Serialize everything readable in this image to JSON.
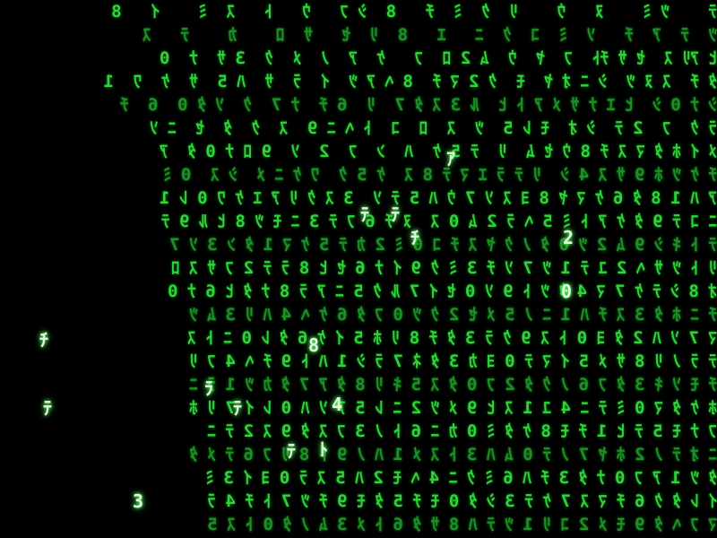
{
  "colors": {
    "background": "#000000",
    "glyph": "#2fd43a",
    "glyph_dim": "#1f8f29",
    "glyph_head": "#d9ffd9"
  },
  "rain": {
    "lines": [
      "ﾃ    ﾂ ﾐ    ﾇ   ｳ    ﾘ  ｸ  ﾐ  ﾁ   8  ｼ ﾌ   ｳ   ﾄ   ｽ  ﾐ    ｲ   8",
      "ﾂ  ﾃ  ｱ  ﾁ   ｿ  ﾐ  ｺ  ｸ  ﾆ   ｴ   8  ﾘ  ｾ   ｻ  ﾛ    ｶ    ﾃ   ｽ",
      "ﾋ ｱﾘ ｽ  ｾ ｻ ﾁﾄ  ﾌ  ﾔ  ｳ  ﾑ 2 ﾛ  ﾌ   ｹ  ｱ  ﾉ  ﾒ  ｸ  3 ｻ  ﾅ  0",
      "ﾀ ﾁ  ｽ ﾇ ﾂ  ｼ ﾆ ｵ ﾔ  ﾓ  ｸ 2 ﾏ ﾁ  8 ﾍ ｱ ﾂ  ｲ  ﾗ  ｻ  ﾊ 5  ｻ  ｹ  ﾜ  1",
      "ｼ ﾅ 0 ｼ  ﾋ ｴ ﾅ ｻ ﾒ ｱ ﾄ ﾋ  ﾙ 3 ｽ ﾀ 7  ﾘ  6 ﾁ  ﾅ 7  ｸ  ｿ ﾀ 0  6  ﾁ",
      "ﾗ ｸ  ﾌ  2 ﾃ  ｼ ｵ  ﾓ ﾚ 5  ﾂ  ｽ  ﾛ  ｺ  ﾄ ﾍ ﾆ 9  ｽ  ｸ  ﾀ  ｾ  ﾆ ｿ",
      "ﾒ ｲ ﾎ ﾀ ﾏ ｽ ﾁ 8 ｳ ｾ ﾑ  ﾘ  ﾃ 5 ｹ  ﾊ  ﾝ  ﾌ  2  ｿ  9 ﾛ ﾅ 0 ﾀ  ｱ",
      "ﾁ ｹ ﾂ ﾎ 9 ｻ ｽ 4 ｼ  ﾘ ﾃ ﾗ ｴ ﾏ ﾃ 8 ｽ  ｹ 5 ｸ  ﾜ ｹ ﾆ ﾒ  ｼ ｽ  0 ﾐ",
      "ｱ ﾊ 1 8 ﾀ 6 ｹ ﾏ ﾔ 8 ﾖ ｽ ｿ 7 ｳ ﾊ 5 ﾃ ｿ  3 ｽ ｸ ﾘ ｱ ｴ ｹ ﾜ 0 ﾚ 1",
      "ﾆ ｺ ﾃ 9 ﾀ ｹ ｱ ﾄ ﾐ 5 ﾍ ﾗ 2 ﾑ 0 ｽ  ﾇ ﾁ 6 ﾌ ﾃ 3 ﾆ ﾓ ﾂ 8 ﾋ ﾙ 9 ﾃ",
      "ﾃ ﾄ ｷ ｼ 9 ﾑ 2 ﾂ 0 ﾀ ﾉ ｸ ﾔ ｽ ﾁ ｺ 0 ﾐ 2 ｶ ﾃ 5 ｹ ﾏ 1 ﾀ ﾝ 3 ｿ 7",
      "ﾘ ﾄ ﾂ ｻ ﾍ 2 ﾕ ﾃ 1 ﾂ 7 ｿ ﾁ 3 ﾐ ｸ 9 ｲ ﾅ 6 ｾ ﾋ 8 ﾗ ﾃ 2 ﾌ ｻ ｽ ﾛ",
      "ｵ 8 ｼ ﾃ ｹ 7 ﾏ 4 ﾀ ﾂ ﾄ 9 ｿ 0 ｾ ｲ 7 ﾙ ｸ 5 ﾆ ｱ ﾗ 8 ﾅ ﾀ ﾋ 6 ﾅ 0",
      "ﾁ ﾆ ﾎ ﾀ 3 ｽ ﾁ ﾊ 1 ﾆ ﾉ 5 ﾒ ｾ 2 ｸ ﾂ 0 ﾌ ﾀ 6 ｹ ﾍ 4 ﾊ ﾘ 3 ﾑ ﾂ",
      "ﾏ 7 ｿ ﾊ 2 ﾀ ﾖ 0 ﾄ ｽ 9 ｸ ﾗ 3 ﾀ ﾁ 8 ﾘ ﾎ 5 ｲ ｹ 6 ﾀ ﾚ 0 ﾆ ﾄ ｽ",
      "ﾃ ﾗ ﾉ ﾘ 8 ｻ ﾒ 5 ｲ ﾏ ﾃ 0 ﾖ ｶ 3 ﾀ ﾈ 7 ﾗ ｼ 1 ﾊ ﾄ 9 ﾁ ﾍ 4 ﾌ ﾘ",
      "ﾁ ﾓ ｿ ｷ 3 ﾀ ﾌ 6 ﾉ ｸ ﾀ 2 ﾌ 0 ﾀ ｽ 5 ｷ ﾘ 8 ﾀ ｱ 7 ﾀ ｶ ﾂ 1 ﾗ ﾆ",
      "ﾎ ｹ ﾀ ﾏ 0 ﾐ ﾃ ﾆ 4 ﾕ 1 ｽ ﾋ 9 ﾒ ﾂ 2 ﾆ ﾚ 5 ｱ ｿ ﾊ 0 ﾚ ｲ 7 ﾘ ﾎ",
      "ﾌ ﾅ ﾓ 5 ﾃ ﾋ 1 ﾁ ﾓ 8 ｹ ﾀ ﾐ 0 ｶ ﾆ 6 ﾄ ﾉ 3 ﾌ ｽ ﾀ 9 ｽ 2 ﾃ ﾆ",
      "ﾆ ｵ ﾃ ﾉ 2 ﾎ ﾔ 7 ﾉ ﾃ 0 ﾑ ﾊ 3 ﾄ ｽ ﾒ 1 ﾊ ﾉ 9 ﾄ 8 ﾘ ﾌ 6 ﾃ ﾒ ﾀ",
      "ﾀ ﾂ 1 ｱ ﾌ 0 ﾅ ﾀ 3 ﾁ ﾊ 6 ﾐ ｸ ﾆ 4 ﾍ ﾓ 2 ﾊ 5 ｽ ﾗ 0 ﾖ ｲ 3 ﾐ",
      "ｲ ﾚ ﾀ ｸ 6 ﾁ ﾏ ｽ 7 ｹ ﾃ 3 ｼ ﾀ 0 ﾓ ﾁ 5 ﾀ ﾓ 9 ﾁ ﾂ 7 ﾄ ﾁ 4 ﾗ",
      "ﾏ ﾌ ﾍ ﾀ 9 ﾓ ﾒ 2 ｺ ﾘ 1 ﾂ ﾃ ﾊ 8 ｻ ﾀ 6 ﾄ ﾒ 3 ﾑ ﾉ ﾀ 0 ﾄ ｽ 5"
    ],
    "highlights": [
      "ｱ",
      "ﾃ",
      "ﾃ",
      "2",
      "ﾁ",
      "0",
      "ﾁ",
      "8",
      "ﾃ",
      "ﾗ",
      "ﾃ",
      "4",
      "ﾃ",
      "ﾄ",
      "3"
    ]
  }
}
